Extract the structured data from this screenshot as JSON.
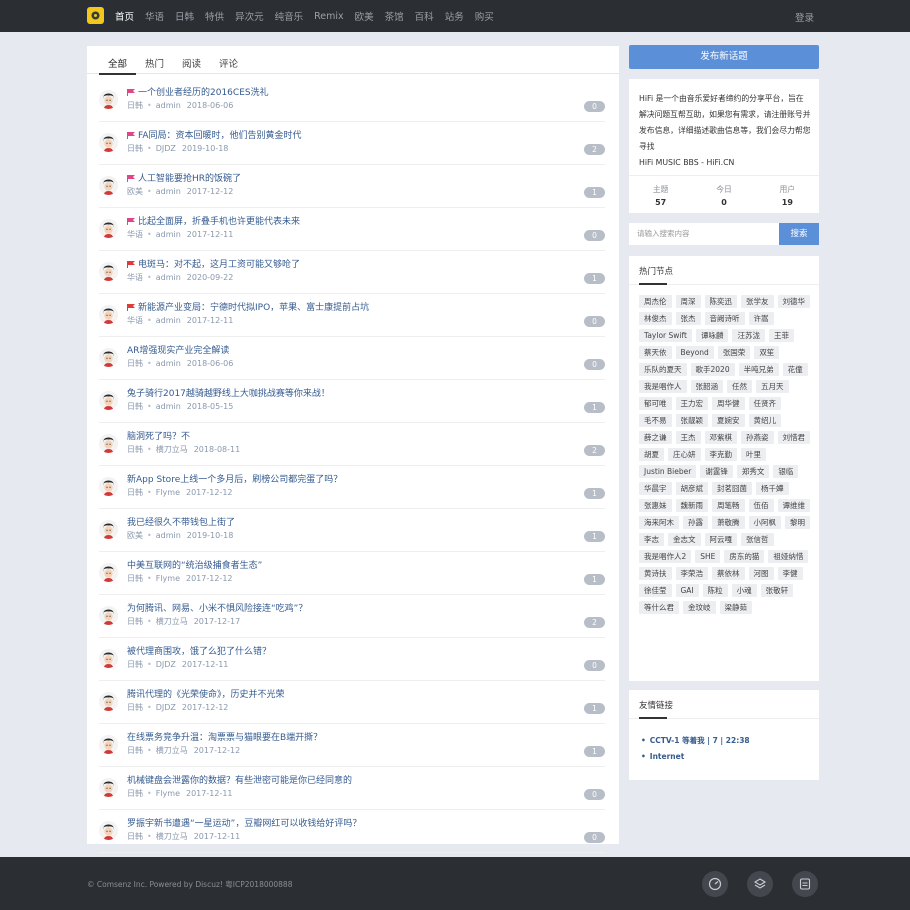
{
  "nav": {
    "items": [
      "首页",
      "华语",
      "日韩",
      "特供",
      "异次元",
      "纯音乐",
      "Remix",
      "欧美",
      "茶馆",
      "百科",
      "站务",
      "购买"
    ],
    "active": 0,
    "login": "登录"
  },
  "tabs": [
    "全部",
    "热门",
    "阅读",
    "评论"
  ],
  "threads": [
    {
      "title": "一个创业者经历的2016CES洗礼",
      "flag": "#e0458a",
      "category": "日韩",
      "author": "admin",
      "date": "2018-06-06",
      "count": "0"
    },
    {
      "title": "FA同局：资本回暖时，他们告别黄金时代",
      "flag": "#e0458a",
      "category": "日韩",
      "author": "DJDZ",
      "date": "2019-10-18",
      "count": "2"
    },
    {
      "title": "人工智能要抢HR的饭碗了",
      "flag": "#e0458a",
      "category": "欧美",
      "author": "admin",
      "date": "2017-12-12",
      "count": "1"
    },
    {
      "title": "比起全面屏，折叠手机也许更能代表未来",
      "flag": "#e0458a",
      "category": "华语",
      "author": "admin",
      "date": "2017-12-11",
      "count": "0"
    },
    {
      "title": "电斑马：对不起，这月工资可能又够呛了",
      "flag": "#e03a3a",
      "category": "华语",
      "author": "admin",
      "date": "2020-09-22",
      "count": "1"
    },
    {
      "title": "新能源产业变局：宁德时代拟IPO，苹果、富士康提前占坑",
      "flag": "#e03a3a",
      "category": "华语",
      "author": "admin",
      "date": "2017-12-11",
      "count": "0"
    },
    {
      "title": "AR增强现实产业完全解读",
      "flag": "",
      "category": "日韩",
      "author": "admin",
      "date": "2018-06-06",
      "count": "0"
    },
    {
      "title": "兔子骑行2017越骑越野线上大咖挑战赛等你来战！",
      "flag": "",
      "category": "日韩",
      "author": "admin",
      "date": "2018-05-15",
      "count": "1"
    },
    {
      "title": "脑洞死了吗？不",
      "flag": "",
      "category": "日韩",
      "author": "横刀立马",
      "date": "2018-08-11",
      "count": "2"
    },
    {
      "title": "新App Store上线一个多月后，刷榜公司都完蛋了吗？",
      "flag": "",
      "category": "日韩",
      "author": "Flyme",
      "date": "2017-12-12",
      "count": "1"
    },
    {
      "title": "我已经很久不带钱包上街了",
      "flag": "",
      "category": "欧美",
      "author": "admin",
      "date": "2019-10-18",
      "count": "1"
    },
    {
      "title": "中美互联网的“统治级捕食者生态”",
      "flag": "",
      "category": "日韩",
      "author": "Flyme",
      "date": "2017-12-12",
      "count": "1"
    },
    {
      "title": "为何腾讯、网易、小米不惧风险接连“吃鸡”？",
      "flag": "",
      "category": "日韩",
      "author": "横刀立马",
      "date": "2017-12-17",
      "count": "2"
    },
    {
      "title": "被代理商围攻，饿了么犯了什么错？",
      "flag": "",
      "category": "日韩",
      "author": "DJDZ",
      "date": "2017-12-11",
      "count": "0"
    },
    {
      "title": "腾讯代理的《光荣使命》，历史并不光荣",
      "flag": "",
      "category": "日韩",
      "author": "DJDZ",
      "date": "2017-12-12",
      "count": "1"
    },
    {
      "title": "在线票务竞争升温：淘票票与猫眼要在B端开撕？",
      "flag": "",
      "category": "日韩",
      "author": "横刀立马",
      "date": "2017-12-12",
      "count": "1"
    },
    {
      "title": "机械键盘会泄露你的数据？有些泄密可能是你已经同意的",
      "flag": "",
      "category": "日韩",
      "author": "Flyme",
      "date": "2017-12-11",
      "count": "0"
    },
    {
      "title": "罗振宇新书遭遇“一星运动”，豆瓣网红可以收钱给好评吗？",
      "flag": "",
      "category": "日韩",
      "author": "横刀立马",
      "date": "2017-12-11",
      "count": "0"
    }
  ],
  "sidebar": {
    "new_topic": "发布新话题",
    "intro": "HiFi 是一个由音乐爱好者缔约的分享平台，旨在解决问题互帮互助，如果您有需求，请注册账号并发布信息，详细描述歌曲信息等，我们会尽力帮您寻找",
    "site": "HiFi MUSIC BBS - HiFi.CN",
    "stats": [
      {
        "label": "主题",
        "value": "57"
      },
      {
        "label": "今日",
        "value": "0"
      },
      {
        "label": "用户",
        "value": "19"
      }
    ],
    "search_placeholder": "请输入搜索内容",
    "search_btn": "搜索",
    "hot_title": "热门节点",
    "tags": [
      "周杰伦",
      "周深",
      "陈奕迅",
      "张学友",
      "刘德华",
      "林俊杰",
      "张杰",
      "音阙诗听",
      "许嵩",
      "Taylor Swift",
      "谭咏麟",
      "汪苏泷",
      "王菲",
      "蔡天依",
      "Beyond",
      "张国荣",
      "双笙",
      "乐队的夏天",
      "歌手2020",
      "半吨兄弟",
      "花僮",
      "我是唱作人",
      "张韶涵",
      "任然",
      "五月天",
      "郁可唯",
      "王力宏",
      "周华健",
      "任贤齐",
      "毛不易",
      "张靓颖",
      "夏婉安",
      "黄绍儿",
      "薛之谦",
      "王杰",
      "邓紫棋",
      "孙燕姿",
      "刘惜君",
      "胡夏",
      "庄心妍",
      "李克勤",
      "叶里",
      "Justin Bieber",
      "谢霆锋",
      "郑秀文",
      "银临",
      "华晨宇",
      "胡彦斌",
      "封茗囧菌",
      "杨千嬅",
      "张惠妹",
      "魏新雨",
      "周笔畅",
      "伍佰",
      "谭维维",
      "海来阿木",
      "孙露",
      "萧敬腾",
      "小阿枫",
      "黎明",
      "李志",
      "金志文",
      "阿云嘎",
      "张信哲",
      "我是唱作人2",
      "SHE",
      "房东的猫",
      "祖娅纳惜",
      "黄诗扶",
      "李荣浩",
      "蔡依林",
      "河图",
      "李健",
      "徐佳莹",
      "GAI",
      "陈粒",
      "小魂",
      "张敬轩",
      "等什么君",
      "金玟岐",
      "梁静茹"
    ],
    "links_title": "友情链接",
    "links": [
      "CCTV-1 等着我 | 7 | 22:38",
      "Internet"
    ]
  },
  "footer": {
    "copyright": "© Comsenz Inc. Powered by Discuz! 粤ICP2018000888"
  },
  "colors": {
    "accent": "#5b8fd8",
    "topbar": "#2b2e33",
    "link": "#355b90"
  }
}
